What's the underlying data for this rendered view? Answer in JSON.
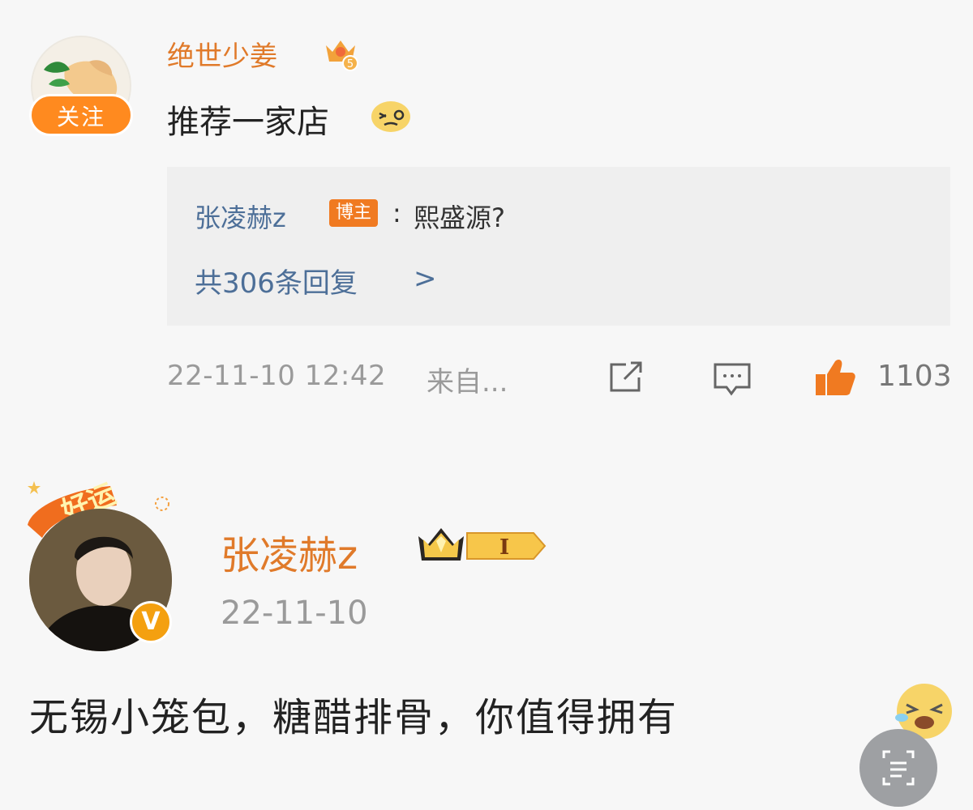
{
  "comment1": {
    "username": "绝世少姜",
    "vip_level": "5",
    "follow_label": "关注",
    "text": "推荐一家店",
    "emoji": "dizzy-face-emoji",
    "reply": {
      "username": "张凌赫z",
      "author_tag": "博主",
      "colon": ":",
      "text": "熙盛源?",
      "count_label": "共306条回复",
      "chevron": ">"
    },
    "time": "22-11-10 12:42",
    "source": "来自...",
    "like_count": "1103"
  },
  "comment2": {
    "badge_text": "好运",
    "username": "张凌赫z",
    "level": "I",
    "date": "22-11-10",
    "text": "无锡小笼包，糖醋排骨，你值得拥有"
  },
  "colors": {
    "username": "#e07a2a",
    "link_blue": "#4d6f98",
    "follow_orange": "#ff8a1f",
    "like_orange": "#f07a21",
    "meta_gray": "#9a9a9a"
  }
}
